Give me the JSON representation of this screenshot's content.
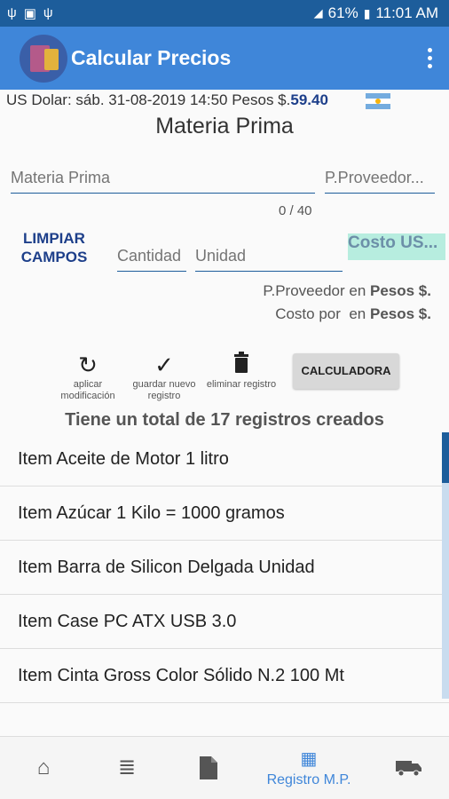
{
  "status_bar": {
    "left_icons": [
      "usb-icon",
      "image-icon",
      "usb-icon"
    ],
    "battery": "61%",
    "time": "11:01 AM"
  },
  "app_bar": {
    "title": "Calcular Precios",
    "menu_icon": "more-vert-icon"
  },
  "exchange": {
    "prefix": "US Dolar: sáb. 31-08-2019 14:50 Pesos $.",
    "value": "59.40",
    "flag_colors": [
      "#74acdf",
      "#ffffff",
      "#74acdf"
    ]
  },
  "form": {
    "section_title": "Materia Prima",
    "materia_placeholder": "Materia Prima",
    "proveedor_placeholder": "P.Proveedor...",
    "counter": "0 / 40",
    "clear_button": "LIMPIAR CAMPOS",
    "cantidad_placeholder": "Cantidad",
    "unidad_placeholder": "Unidad",
    "costo_label": "Costo US...",
    "note1_pre": "P.Proveedor",
    "note1_mid": " en ",
    "note1_bold": "Pesos $.",
    "note2_pre": "Costo por",
    "note2_mid": "  en ",
    "note2_bold": "Pesos $."
  },
  "actions": [
    {
      "icon": "undo-icon",
      "label": "aplicar modificación"
    },
    {
      "icon": "check-icon",
      "label": "guardar nuevo registro"
    },
    {
      "icon": "trash-icon",
      "label": "eliminar registro"
    }
  ],
  "calculator_button": "CALCULADORA",
  "total_text": "Tiene un total de 17 registros creados",
  "items": [
    "Item Aceite de Motor 1 litro",
    "Item Azúcar 1 Kilo = 1000 gramos",
    "Item Barra de Silicon Delgada Unidad",
    "Item Case PC ATX USB 3.0",
    "Item Cinta Gross Color Sólido N.2 100 Mt"
  ],
  "bottom_nav": {
    "home_icon": "home-icon",
    "list_icon": "list-icon",
    "document_icon": "document-icon",
    "active_label": "Registro M.P.",
    "active_icon": "grid-icon",
    "truck_icon": "truck-icon"
  },
  "colors": {
    "status_bar": "#1d5d9b",
    "app_bar": "#3f86d9",
    "accent": "#1d3f8a",
    "costo_bg": "#b7eddf"
  }
}
